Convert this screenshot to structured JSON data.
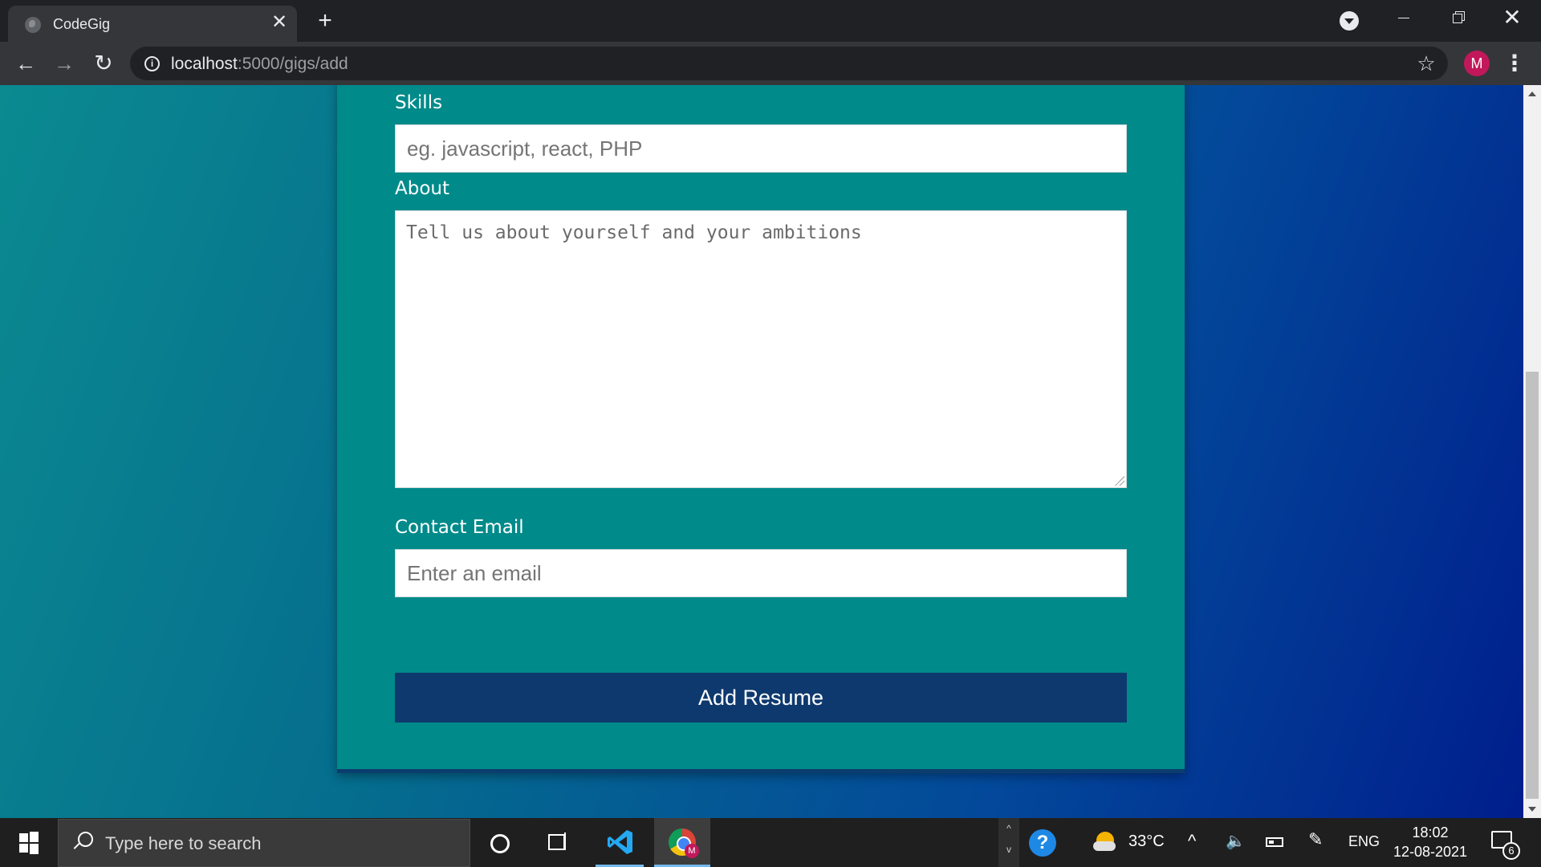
{
  "browser": {
    "tab_title": "CodeGig",
    "tab_close_glyph": "✕",
    "new_tab_glyph": "+",
    "url_host": "localhost",
    "url_rest": ":5000/gigs/add",
    "profile_initial": "M",
    "menu_glyph": "⋮",
    "star_glyph": "☆",
    "back_glyph": "←",
    "forward_glyph": "→",
    "reload_glyph": "↻",
    "close_glyph": "✕",
    "info_glyph": "i"
  },
  "form": {
    "skills": {
      "label": "Skills",
      "placeholder": "eg. javascript, react, PHP"
    },
    "about": {
      "label": "About",
      "placeholder": "Tell us about yourself and your ambitions"
    },
    "email": {
      "label": "Contact Email",
      "placeholder": "Enter an email"
    },
    "submit_label": "Add Resume"
  },
  "taskbar": {
    "search_placeholder": "Type here to search",
    "help_glyph": "?",
    "temperature": "33°C",
    "language": "ENG",
    "time": "18:02",
    "date": "12-08-2021",
    "notification_count": "6",
    "chrome_badge": "M",
    "tray_up": "^",
    "tray_down": "v",
    "chevron_glyph": "^",
    "volume_glyph": "🔈",
    "pen_glyph": "✎"
  },
  "colors": {
    "card": "#008a8a",
    "button": "#0e396e",
    "gradient_start": "#0b8a90",
    "gradient_end": "#001e8c",
    "avatar": "#c2185b"
  },
  "icons": [
    "globe-favicon-icon",
    "close-icon",
    "plus-icon",
    "tab-search-icon",
    "minimize-icon",
    "restore-icon",
    "back-arrow-icon",
    "forward-arrow-icon",
    "reload-icon",
    "info-icon",
    "star-icon",
    "kebab-menu-icon",
    "windows-start-icon",
    "search-icon",
    "cortana-icon",
    "task-view-icon",
    "vscode-icon",
    "chrome-icon",
    "help-icon",
    "weather-icon",
    "chevron-up-icon",
    "volume-icon",
    "battery-icon",
    "pen-icon",
    "notification-icon"
  ]
}
